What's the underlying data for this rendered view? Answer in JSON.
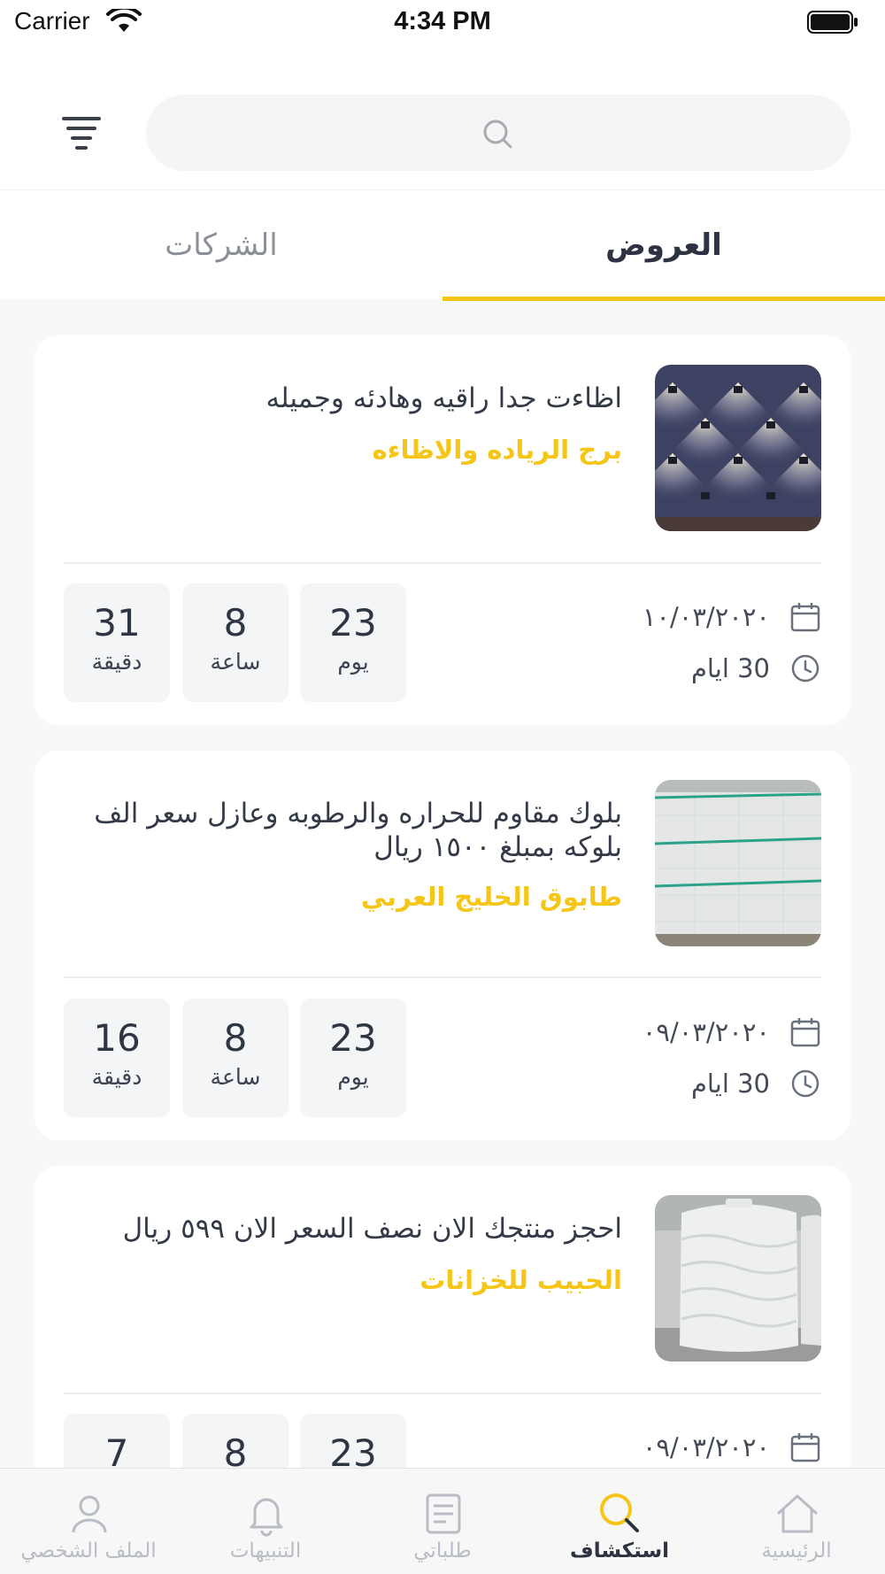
{
  "status_bar": {
    "carrier": "Carrier",
    "time": "4:34 PM"
  },
  "search": {
    "placeholder": "",
    "value": ""
  },
  "tabs": [
    {
      "label": "العروض",
      "active": true
    },
    {
      "label": "الشركات",
      "active": false
    }
  ],
  "colors": {
    "accent": "#f5c518",
    "text_dark": "#343a47",
    "text_muted": "#8a8f98"
  },
  "offers": [
    {
      "title": "اظاءت جدا راقيه وهادئه وجميله",
      "company": "برج الرياده والاظاءه",
      "date": "١٠/٠٣/٢٠٢٠",
      "duration": "30 ايام",
      "countdown": {
        "days": "23",
        "days_label": "يوم",
        "hours": "8",
        "hours_label": "ساعة",
        "minutes": "31",
        "minutes_label": "دقيقة"
      },
      "image": "wall-lights-image"
    },
    {
      "title": "بلوك مقاوم للحراره والرطوبه وعازل سعر الف بلوكه بمبلغ ١٥٠٠ ريال",
      "company": "طابوق الخليج العربي",
      "date": "٠٩/٠٣/٢٠٢٠",
      "duration": "30 ايام",
      "countdown": {
        "days": "23",
        "days_label": "يوم",
        "hours": "8",
        "hours_label": "ساعة",
        "minutes": "16",
        "minutes_label": "دقيقة"
      },
      "image": "blocks-image"
    },
    {
      "title": "احجز منتجك الان نصف السعر الان ٥٩٩ ريال",
      "company": "الحبيب للخزانات",
      "date": "٠٩/٠٣/٢٠٢٠",
      "duration": "",
      "countdown": {
        "days": "23",
        "days_label": "",
        "hours": "8",
        "hours_label": "",
        "minutes": "7",
        "minutes_label": ""
      },
      "image": "water-tank-image"
    }
  ],
  "bottom_nav": [
    {
      "label": "الرئيسية",
      "icon": "home-icon",
      "active": false
    },
    {
      "label": "استكشاف",
      "icon": "explore-icon",
      "active": true
    },
    {
      "label": "طلباتي",
      "icon": "orders-icon",
      "active": false
    },
    {
      "label": "التنبيهات",
      "icon": "bell-icon",
      "active": false
    },
    {
      "label": "الملف الشخصي",
      "icon": "profile-icon",
      "active": false
    }
  ]
}
